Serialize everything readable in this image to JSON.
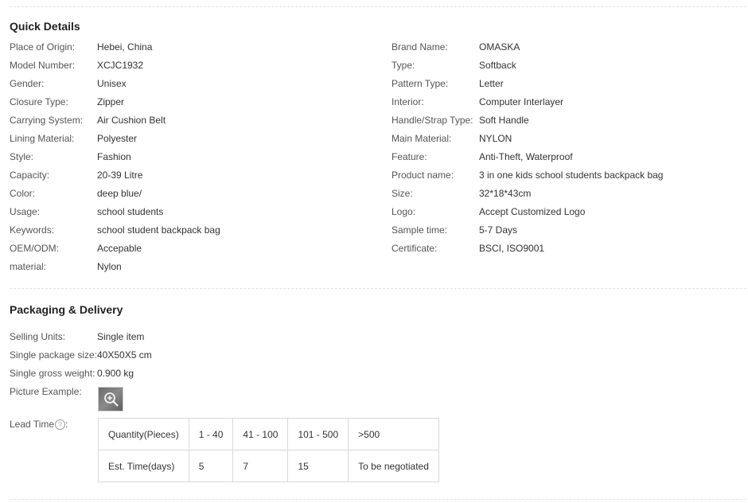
{
  "quick_details": {
    "title": "Quick Details",
    "left": [
      {
        "label": "Place of Origin:",
        "value": "Hebei, China"
      },
      {
        "label": "Model Number:",
        "value": "XCJC1932"
      },
      {
        "label": "Gender:",
        "value": "Unisex"
      },
      {
        "label": "Closure Type:",
        "value": "Zipper"
      },
      {
        "label": "Carrying System:",
        "value": "Air Cushion Belt"
      },
      {
        "label": "Lining Material:",
        "value": "Polyester"
      },
      {
        "label": "Style:",
        "value": "Fashion"
      },
      {
        "label": "Capacity:",
        "value": "20-39 Litre"
      },
      {
        "label": "Color:",
        "value": "deep blue/"
      },
      {
        "label": "Usage:",
        "value": "school students"
      },
      {
        "label": "Keywords:",
        "value": "school student backpack bag"
      },
      {
        "label": "OEM/ODM:",
        "value": "Accepable"
      },
      {
        "label": "material:",
        "value": "Nylon"
      }
    ],
    "right": [
      {
        "label": "Brand Name:",
        "value": "OMASKA"
      },
      {
        "label": "Type:",
        "value": "Softback"
      },
      {
        "label": "Pattern Type:",
        "value": "Letter"
      },
      {
        "label": "Interior:",
        "value": "Computer Interlayer"
      },
      {
        "label": "Handle/Strap Type:",
        "value": "Soft Handle"
      },
      {
        "label": "Main Material:",
        "value": "NYLON"
      },
      {
        "label": "Feature:",
        "value": "Anti-Theft, Waterproof"
      },
      {
        "label": "Product name:",
        "value": "3 in one kids school students backpack bag"
      },
      {
        "label": "Size:",
        "value": "32*18*43cm"
      },
      {
        "label": "Logo:",
        "value": "Accept Customized Logo"
      },
      {
        "label": "Sample time:",
        "value": "5-7 Days"
      },
      {
        "label": "Certificate:",
        "value": "BSCI, ISO9001"
      }
    ]
  },
  "packaging": {
    "title": "Packaging & Delivery",
    "items": [
      {
        "label": "Selling Units:",
        "value": "Single item"
      },
      {
        "label": "Single package size:",
        "value": "40X50X5 cm"
      },
      {
        "label": "Single gross weight:",
        "value": "0.900 kg"
      }
    ],
    "picture_label": "Picture Example:",
    "picture_icon": "zoom-in-icon",
    "lead_time_label": "Lead Time",
    "lead_time_suffix": ":",
    "help_glyph": "?",
    "lead_table": {
      "rows": [
        [
          "Quantity(Pieces)",
          "1 - 40",
          "41 - 100",
          "101 - 500",
          ">500"
        ],
        [
          "Est. Time(days)",
          "5",
          "7",
          "15",
          "To be negotiated"
        ]
      ]
    }
  }
}
